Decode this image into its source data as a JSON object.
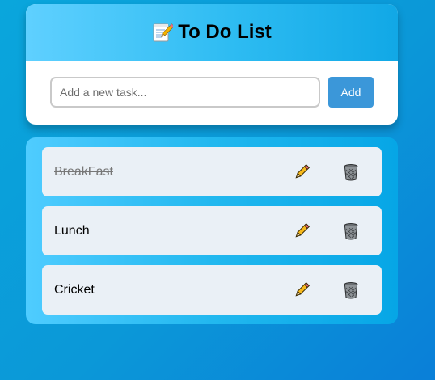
{
  "header": {
    "title": "To Do List",
    "title_icon": "memo-emoji-icon"
  },
  "add_task": {
    "placeholder": "Add a new task...",
    "value": "",
    "button_label": "Add"
  },
  "tasks": [
    {
      "text": "BreakFast",
      "completed": true
    },
    {
      "text": "Lunch",
      "completed": false
    },
    {
      "text": "Cricket",
      "completed": false
    }
  ],
  "icons": {
    "edit": "pencil-icon",
    "delete": "trash-icon"
  },
  "colors": {
    "accent": "#3b97d9",
    "header_gradient_start": "#5fd0ff",
    "header_gradient_end": "#11a8e6",
    "item_background": "#eaf0f6"
  }
}
